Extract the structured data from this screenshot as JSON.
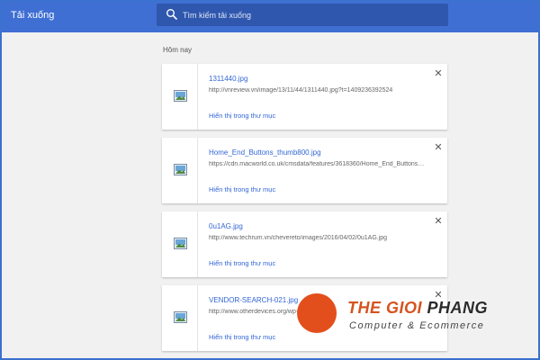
{
  "header": {
    "title": "Tải xuống",
    "search_placeholder": "Tìm kiếm tải xuống"
  },
  "section": {
    "label": "Hôm nay"
  },
  "downloads": [
    {
      "name": "1311440.jpg",
      "url": "http://vnreview.vn/image/13/11/44/1311440.jpg?t=1409236392524",
      "action": "Hiển thị trong thư mục"
    },
    {
      "name": "Home_End_Buttons_thumb800.jpg",
      "url": "https://cdn.macworld.co.uk/cmsdata/features/3618360/Home_End_Buttons_thu...",
      "action": "Hiển thị trong thư mục"
    },
    {
      "name": "0u1AG.jpg",
      "url": "http://www.techrum.vn/chevereto/images/2016/04/02/0u1AG.jpg",
      "action": "Hiển thị trong thư mục"
    },
    {
      "name": "VENDOR-SEARCH-021.jpg",
      "url": "http://www.otherdevices.org/wp-c...",
      "action": "Hiển thị trong thư mục"
    }
  ],
  "watermark": {
    "brand_main": "THE GIOI",
    "brand_tail": "PHANG",
    "tagline": "Computer & Ecommerce"
  },
  "colors": {
    "header_bg": "#3f6fd3",
    "search_bg": "#2f57ae",
    "link": "#3367d6",
    "watermark_orange": "#e34f1c"
  },
  "icons": {
    "search": "search-icon",
    "file": "image-file-icon",
    "close": "close-icon"
  }
}
